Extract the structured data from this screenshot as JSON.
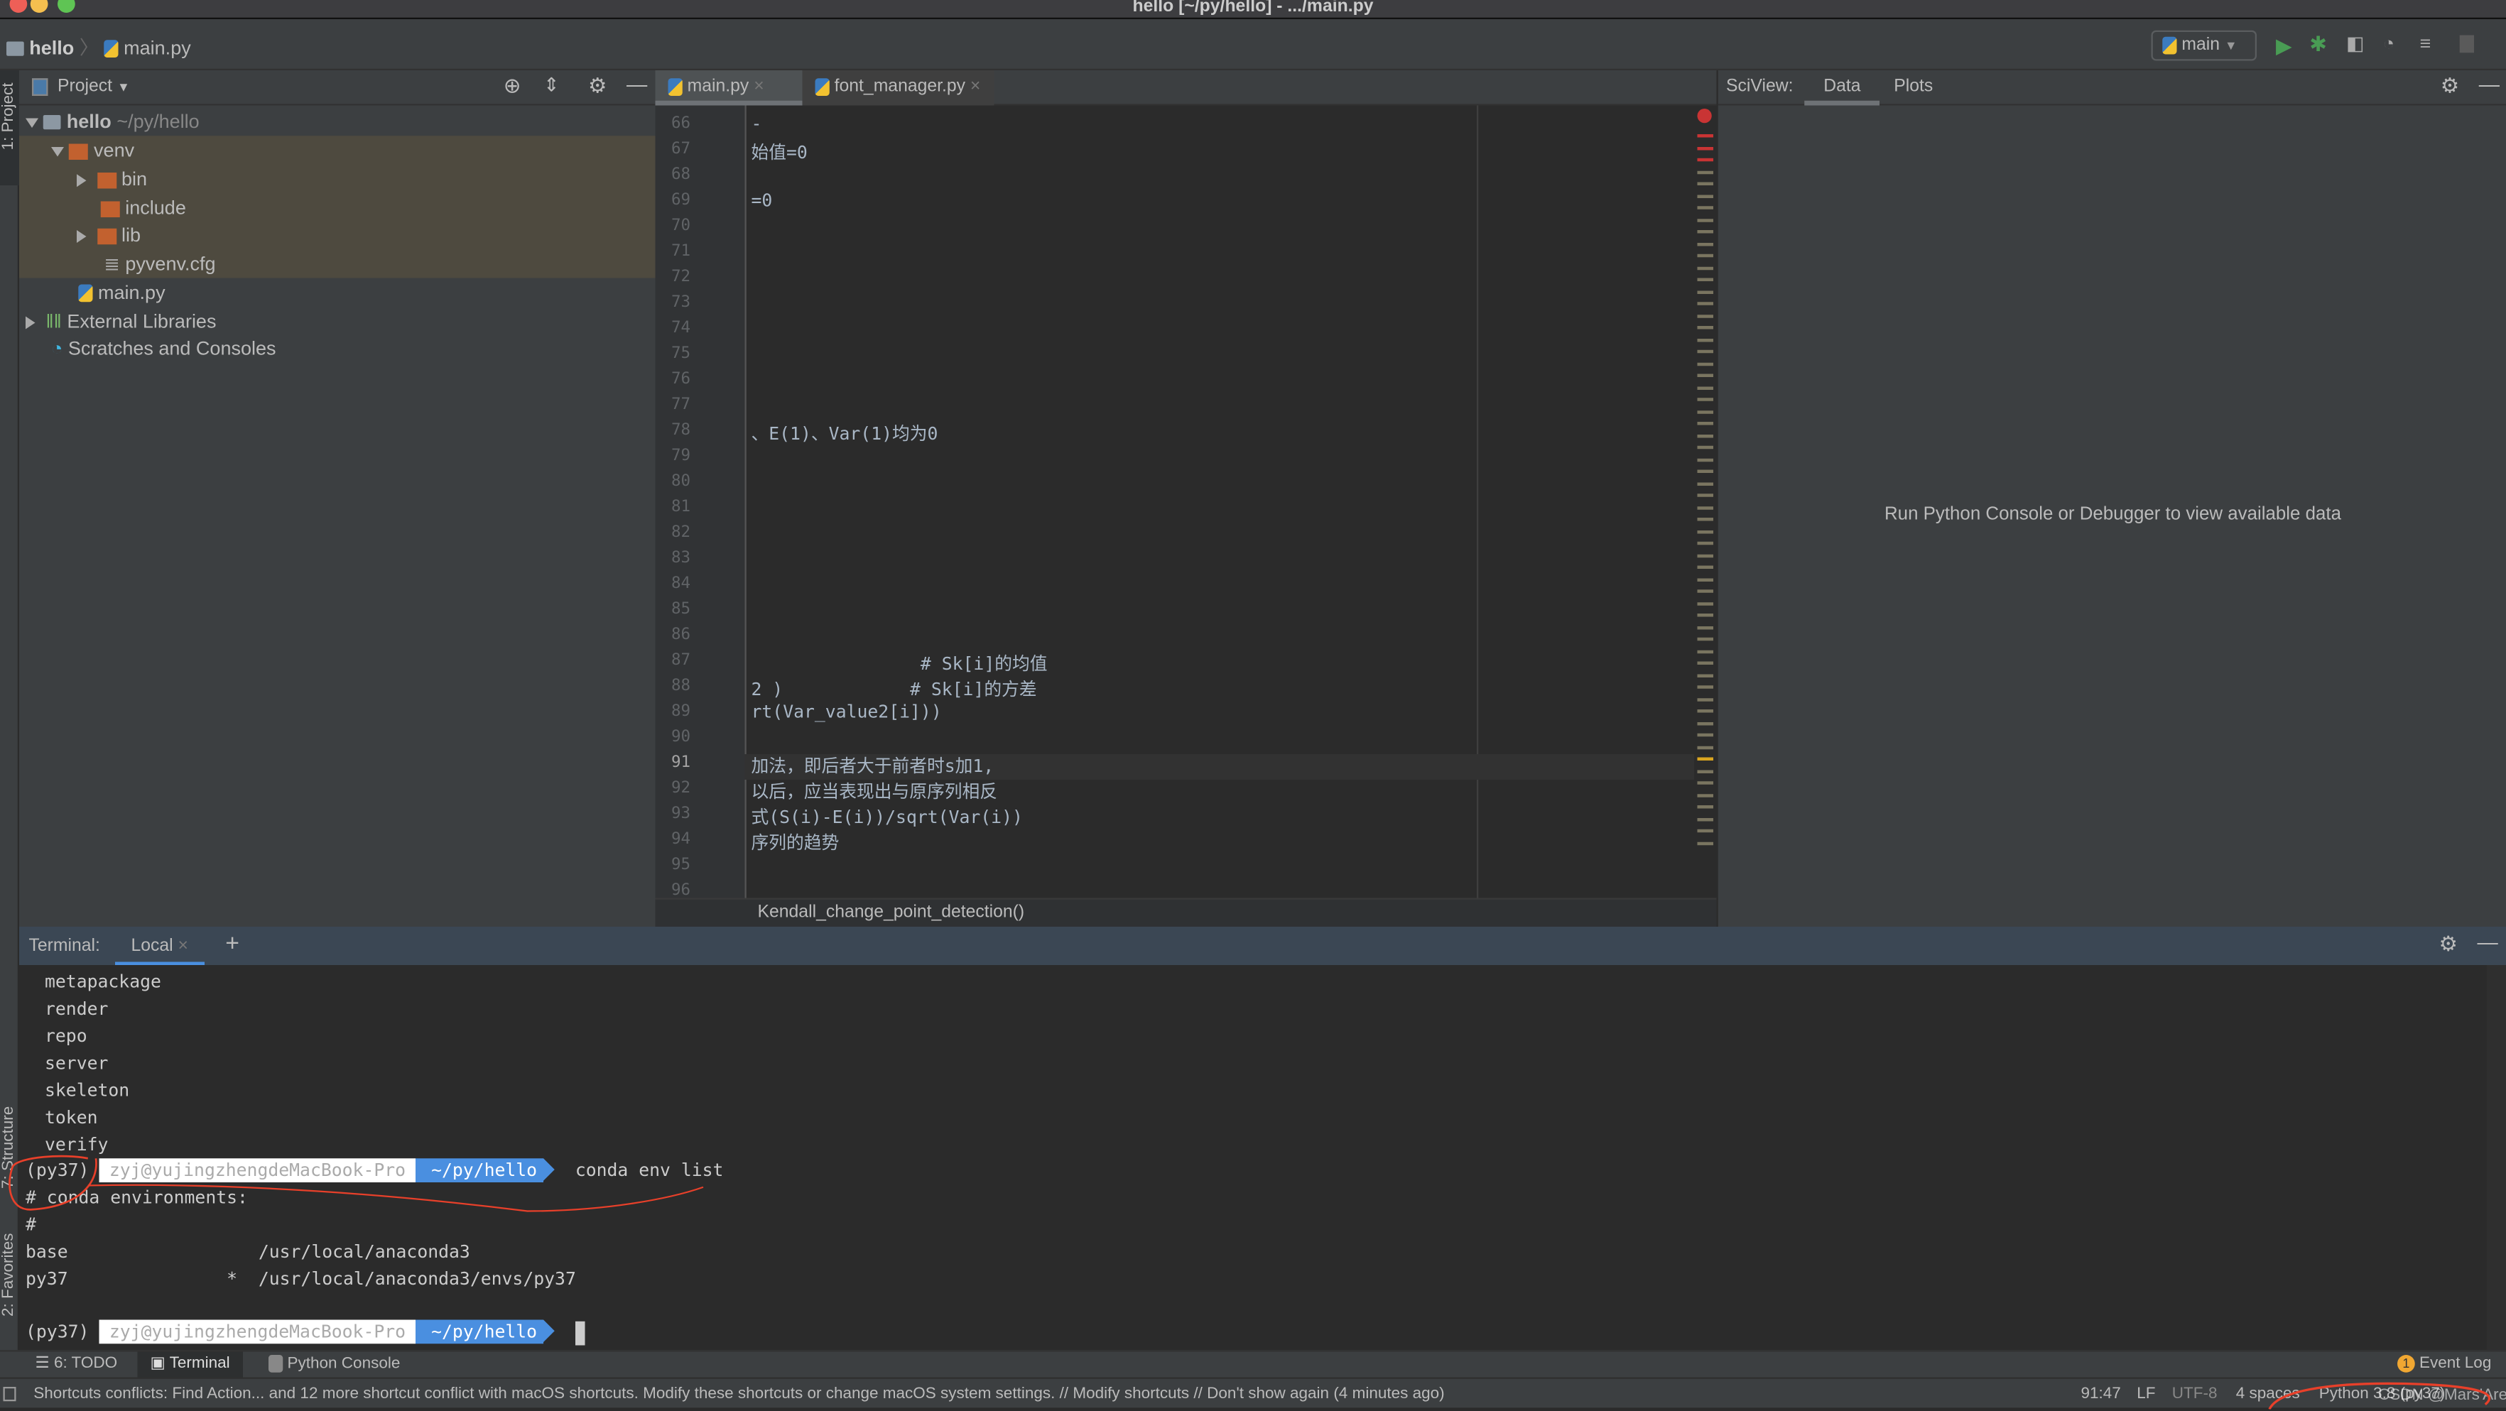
{
  "window": {
    "title": "hello [~/py/hello] - .../main.py"
  },
  "navbar": {
    "breadcrumb": [
      "hello",
      "main.py"
    ],
    "run_config": "main"
  },
  "left_strip": {
    "project": "1: Project",
    "structure": "7: Structure",
    "favorites": "2: Favorites"
  },
  "project": {
    "header": "Project",
    "tree": [
      {
        "label": "hello",
        "suffix": "~/py/hello",
        "level": 0,
        "expanded": true,
        "type": "folder"
      },
      {
        "label": "venv",
        "level": 1,
        "expanded": true,
        "type": "excluded-folder"
      },
      {
        "label": "bin",
        "level": 2,
        "expanded": false,
        "type": "excluded-folder"
      },
      {
        "label": "include",
        "level": 2,
        "type": "excluded-folder"
      },
      {
        "label": "lib",
        "level": 2,
        "expanded": false,
        "type": "excluded-folder"
      },
      {
        "label": "pyvenv.cfg",
        "level": 2,
        "type": "file"
      },
      {
        "label": "main.py",
        "level": 1,
        "type": "python"
      },
      {
        "label": "External Libraries",
        "level": 0,
        "expanded": false,
        "type": "library"
      },
      {
        "label": "Scratches and Consoles",
        "level": 0,
        "type": "scratch"
      }
    ]
  },
  "editor": {
    "tabs": [
      {
        "label": "main.py",
        "active": true
      },
      {
        "label": "font_manager.py",
        "active": false
      }
    ],
    "current_line": 91,
    "lines": [
      {
        "n": 66,
        "text": "-"
      },
      {
        "n": 67,
        "text": "始值=0"
      },
      {
        "n": 68,
        "text": ""
      },
      {
        "n": 69,
        "text": "=0"
      },
      {
        "n": 70,
        "text": ""
      },
      {
        "n": 71,
        "text": ""
      },
      {
        "n": 72,
        "text": ""
      },
      {
        "n": 73,
        "text": ""
      },
      {
        "n": 74,
        "text": ""
      },
      {
        "n": 75,
        "text": ""
      },
      {
        "n": 76,
        "text": ""
      },
      {
        "n": 77,
        "text": ""
      },
      {
        "n": 78,
        "text": "、E(1)、Var(1)均为0"
      },
      {
        "n": 79,
        "text": ""
      },
      {
        "n": 80,
        "text": ""
      },
      {
        "n": 81,
        "text": ""
      },
      {
        "n": 82,
        "text": ""
      },
      {
        "n": 83,
        "text": ""
      },
      {
        "n": 84,
        "text": ""
      },
      {
        "n": 85,
        "text": ""
      },
      {
        "n": 86,
        "text": ""
      },
      {
        "n": 87,
        "text": "                # Sk[i]的均值"
      },
      {
        "n": 88,
        "text": "2 )            # Sk[i]的方差"
      },
      {
        "n": 89,
        "text": "rt(Var_value2[i]))"
      },
      {
        "n": 90,
        "text": ""
      },
      {
        "n": 91,
        "text": "加法，即后者大于前者时s加1,"
      },
      {
        "n": 92,
        "text": "以后，应当表现出与原序列相反"
      },
      {
        "n": 93,
        "text": "式(S(i)-E(i))/sqrt(Var(i))"
      },
      {
        "n": 94,
        "text": "序列的趋势"
      },
      {
        "n": 95,
        "text": ""
      },
      {
        "n": 96,
        "text": ""
      }
    ],
    "breadcrumb": "Kendall_change_point_detection()"
  },
  "sciview": {
    "label": "SciView:",
    "tabs": [
      "Data",
      "Plots"
    ],
    "active_tab": "Data",
    "message": "Run Python Console or Debugger to view available data"
  },
  "terminal": {
    "label": "Terminal:",
    "tab": "Local",
    "output": [
      "metapackage",
      "render",
      "repo",
      "server",
      "skeleton",
      "token",
      "verify"
    ],
    "prompt": {
      "env": "(py37)",
      "host": "zyj@yujingzhengdeMacBook-Pro",
      "path": "~/py/hello"
    },
    "command": "conda env list",
    "result": [
      "# conda environments:",
      "#",
      "base                  /usr/local/anaconda3",
      "py37               *  /usr/local/anaconda3/envs/py37"
    ]
  },
  "tool_tabs": [
    {
      "label": "6: TODO"
    },
    {
      "label": "Terminal",
      "active": true
    },
    {
      "label": "Python Console"
    }
  ],
  "event_log": {
    "label": "Event Log",
    "count": "1"
  },
  "status": {
    "message": "Shortcuts conflicts: Find Action... and 12 more shortcut conflict with macOS shortcuts. Modify these shortcuts or change macOS system settings. // Modify shortcuts // Don't show again (4 minutes ago)",
    "position": "91:47",
    "line_sep": "LF",
    "encoding": "UTF-8",
    "indent": "4 spaces",
    "interpreter": "Python 3.8 (py37)",
    "watermark": "CSDN @Mars'Ares"
  },
  "colors": {
    "accent": "#4a8fe0",
    "annotation": "#e8402a",
    "excluded_folder": "#c2612f",
    "run": "#499c54"
  }
}
